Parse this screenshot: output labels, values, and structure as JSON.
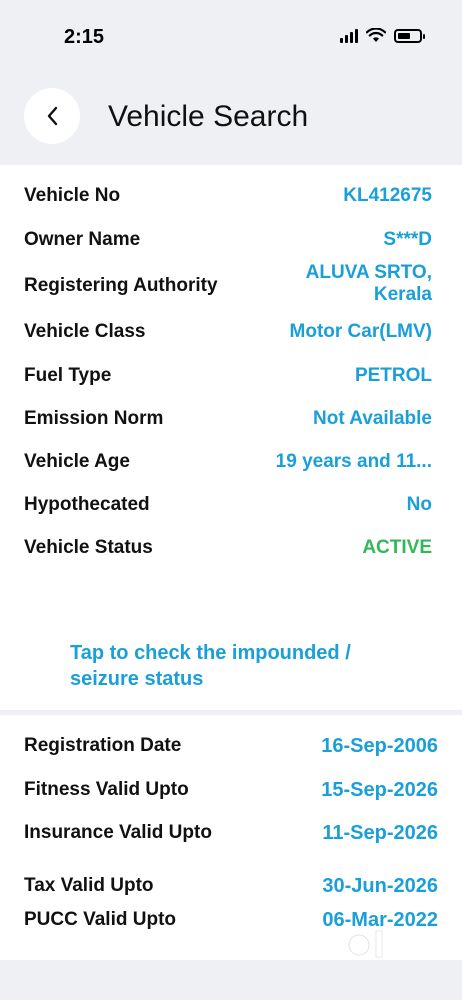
{
  "status_bar": {
    "time": "2:15"
  },
  "header": {
    "title": "Vehicle Search"
  },
  "details": [
    {
      "label": "Vehicle No",
      "value": "KL412675"
    },
    {
      "label": "Owner Name",
      "value": "S***D"
    },
    {
      "label": "Registering Authority",
      "value": "ALUVA SRTO, Kerala"
    },
    {
      "label": "Vehicle Class",
      "value": "Motor Car(LMV)"
    },
    {
      "label": "Fuel Type",
      "value": "PETROL"
    },
    {
      "label": "Emission Norm",
      "value": "Not Available"
    },
    {
      "label": "Vehicle Age",
      "value": "19 years and 11..."
    },
    {
      "label": "Hypothecated",
      "value": "No"
    },
    {
      "label": "Vehicle Status",
      "value": "ACTIVE"
    }
  ],
  "impound_link": "Tap to check the impounded / seizure status",
  "validity": [
    {
      "label": "Registration Date",
      "value": "16-Sep-2006"
    },
    {
      "label": "Fitness Valid Upto",
      "value": "15-Sep-2026"
    },
    {
      "label": "Insurance Valid Upto",
      "value": "11-Sep-2026"
    },
    {
      "label": "Tax Valid Upto",
      "value": "30-Jun-2026"
    },
    {
      "label": "PUCC Valid Upto",
      "value": "06-Mar-2022"
    }
  ],
  "colors": {
    "accent": "#1a9fd9",
    "active": "#34b758",
    "background": "#eef0f3"
  },
  "watermark": {
    "text": "OLX",
    "icon": "olx-logo-icon"
  }
}
